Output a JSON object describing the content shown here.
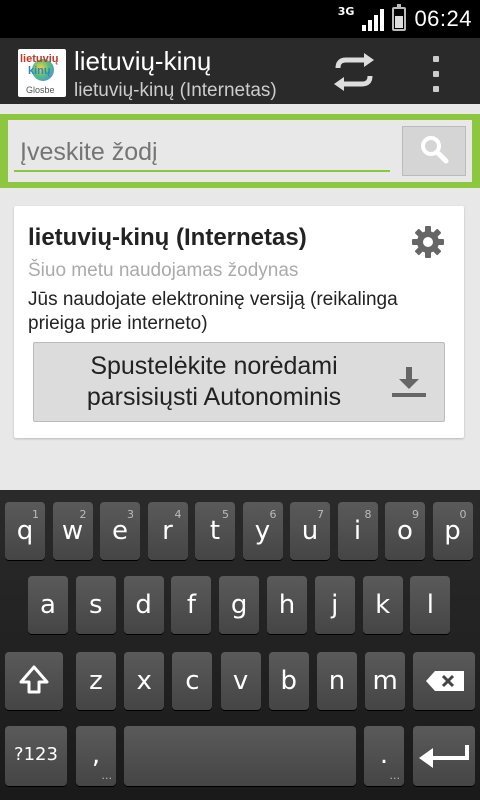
{
  "status_bar": {
    "network": "3G",
    "time": "06:24"
  },
  "action_bar": {
    "logo_text_1": "lietuvių",
    "logo_text_2": "kinų",
    "logo_brand": "Glosbe",
    "title": "lietuvių-kinų",
    "subtitle": "lietuvių-kinų (Internetas)"
  },
  "search": {
    "placeholder": "Įveskite žodį"
  },
  "card": {
    "title": "lietuvių-kinų (Internetas)",
    "status": "Šiuo metu naudojamas žodynas",
    "description": "Jūs naudojate elektroninę versiją (reikalinga prieiga prie interneto)",
    "download_label": "Spustelėkite norėdami parsisiųsti Autonominis"
  },
  "keyboard": {
    "row1": [
      {
        "key": "q",
        "hint": "1"
      },
      {
        "key": "w",
        "hint": "2"
      },
      {
        "key": "e",
        "hint": "3"
      },
      {
        "key": "r",
        "hint": "4"
      },
      {
        "key": "t",
        "hint": "5"
      },
      {
        "key": "y",
        "hint": "6"
      },
      {
        "key": "u",
        "hint": "7"
      },
      {
        "key": "i",
        "hint": "8"
      },
      {
        "key": "o",
        "hint": "9"
      },
      {
        "key": "p",
        "hint": "0"
      }
    ],
    "row2": [
      "a",
      "s",
      "d",
      "f",
      "g",
      "h",
      "j",
      "k",
      "l"
    ],
    "row3": [
      "z",
      "x",
      "c",
      "v",
      "b",
      "n",
      "m"
    ],
    "symbols_label": "?123",
    "comma": ",",
    "period": ".",
    "more_hint": "..."
  },
  "colors": {
    "accent": "#8dc63f",
    "actionbar": "#2a2a2a",
    "background": "#e8e8e8"
  }
}
